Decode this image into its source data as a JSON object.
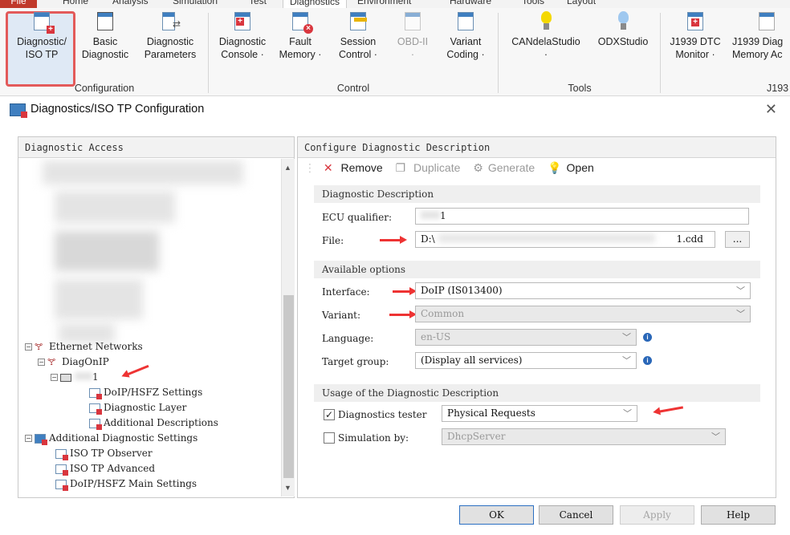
{
  "menubar": {
    "file": "File",
    "tabs": [
      "Home",
      "Analysis",
      "Simulation",
      "Test",
      "Diagnostics",
      "Environment",
      "Hardware",
      "Tools",
      "Layout"
    ]
  },
  "ribbon": {
    "buttons": [
      {
        "line1": "Diagnostic/",
        "line2": "ISO TP"
      },
      {
        "line1": "Basic",
        "line2": "Diagnostic"
      },
      {
        "line1": "Diagnostic",
        "line2": "Parameters"
      },
      {
        "line1": "Diagnostic",
        "line2": "Console ·"
      },
      {
        "line1": "Fault",
        "line2": "Memory ·"
      },
      {
        "line1": "Session",
        "line2": "Control ·"
      },
      {
        "line1": "OBD-II",
        "line2": "·"
      },
      {
        "line1": "Variant",
        "line2": "Coding ·"
      },
      {
        "line1": "CANdelaStudio",
        "line2": "·"
      },
      {
        "line1": "ODXStudio",
        "line2": ""
      },
      {
        "line1": "J1939 DTC",
        "line2": "Monitor ·"
      },
      {
        "line1": "J1939 Diag",
        "line2": "Memory Ac"
      }
    ],
    "groups": [
      "Configuration",
      "Control",
      "Tools",
      "J193"
    ]
  },
  "dialog": {
    "title": "Diagnostics/ISO TP Configuration",
    "left": {
      "header": "Diagnostic Access",
      "tree": {
        "ethernet": "Ethernet Networks",
        "diagonip": "DiagOnIP",
        "node": "1",
        "doip_settings": "DoIP/HSFZ Settings",
        "diag_layer": "Diagnostic Layer",
        "add_desc": "Additional Descriptions",
        "add_diag": "Additional Diagnostic Settings",
        "iso_observer": "ISO TP Observer",
        "iso_advanced": "ISO TP Advanced",
        "doip_main": "DoIP/HSFZ Main Settings"
      }
    },
    "right": {
      "header": "Configure Diagnostic Description",
      "toolbar": {
        "remove": "Remove",
        "duplicate": "Duplicate",
        "generate": "Generate",
        "open": "Open"
      },
      "desc_section": "Diagnostic Description",
      "ecu_label": "ECU qualifier:",
      "ecu_value": "1",
      "file_label": "File:",
      "file_value_start": "D:\\",
      "file_value_end": "1.cdd",
      "browse": "...",
      "options_section": "Available options",
      "interface_label": "Interface:",
      "interface_value": "DoIP (IS013400)",
      "variant_label": "Variant:",
      "variant_value": "Common",
      "language_label": "Language:",
      "language_value": "en-US",
      "target_label": "Target group:",
      "target_value": "(Display all services)",
      "usage_section": "Usage of the Diagnostic Description",
      "tester_label": "Diagnostics tester",
      "tester_value": "Physical Requests",
      "sim_label": "Simulation by:",
      "sim_value": "DhcpServer"
    },
    "buttons": {
      "ok": "OK",
      "cancel": "Cancel",
      "apply": "Apply",
      "help": "Help"
    }
  }
}
